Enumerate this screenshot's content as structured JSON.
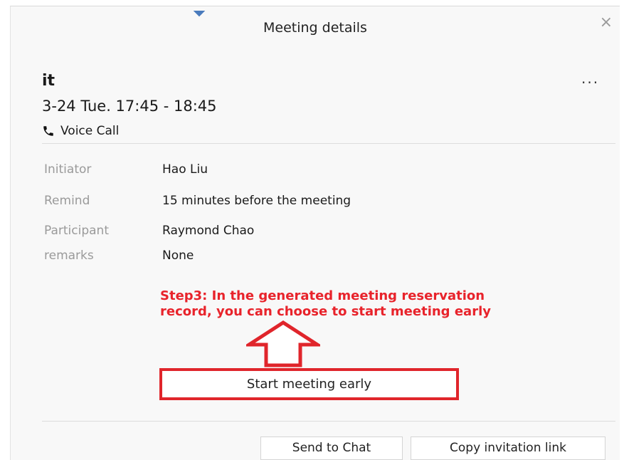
{
  "dialog": {
    "title": "Meeting details",
    "close_glyph": "×",
    "more_glyph": "..."
  },
  "meeting": {
    "name": "it",
    "time": "3-24 Tue. 17:45 - 18:45",
    "call_type": "Voice Call",
    "call_icon": "phone-icon"
  },
  "details": [
    {
      "label": "Initiator",
      "value": "Hao Liu"
    },
    {
      "label": "Remind",
      "value": "15 minutes before the meeting"
    },
    {
      "label": "Participant",
      "value": "Raymond Chao"
    },
    {
      "label": "remarks",
      "value": "None"
    }
  ],
  "annotation": {
    "line1": "Step3: In the generated meeting reservation",
    "line2": "record, you can choose to start meeting early",
    "color": "#e8232b"
  },
  "actions": {
    "start_early_label": "Start meeting early",
    "send_to_chat_label": "Send to Chat",
    "copy_link_label": "Copy invitation link"
  },
  "colors": {
    "highlight": "#e0252b",
    "background": "#f8f8f8",
    "caret": "#4a7bbd"
  }
}
